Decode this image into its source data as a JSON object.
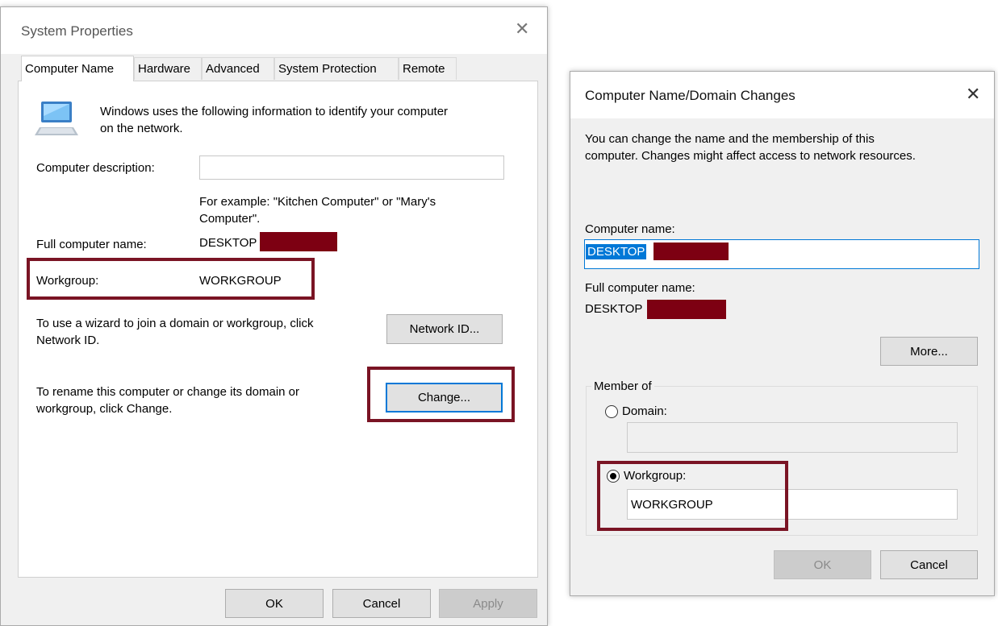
{
  "system_properties": {
    "title": "System Properties",
    "tabs": [
      {
        "label": "Computer Name",
        "active": true
      },
      {
        "label": "Hardware"
      },
      {
        "label": "Advanced"
      },
      {
        "label": "System Protection"
      },
      {
        "label": "Remote"
      }
    ],
    "intro_text_1": "Windows uses the following information to identify your computer",
    "intro_text_2": "on the network.",
    "computer_description_label": "Computer description:",
    "computer_description_value": "",
    "example_text_1": "For example: \"Kitchen Computer\" or \"Mary's",
    "example_text_2": "Computer\".",
    "full_name_label": "Full computer name:",
    "full_name_value": "DESKTOP",
    "workgroup_label": "Workgroup:",
    "workgroup_value": "WORKGROUP",
    "network_id_text_1": "To use a wizard to join a domain or workgroup, click",
    "network_id_text_2": "Network ID.",
    "network_id_button": "Network ID...",
    "rename_text_1": "To rename this computer or change its domain or",
    "rename_text_2": "workgroup, click Change.",
    "change_button": "Change...",
    "ok_button": "OK",
    "cancel_button": "Cancel",
    "apply_button": "Apply"
  },
  "domain_changes": {
    "title": "Computer Name/Domain Changes",
    "intro_text_1": "You can change the name and the membership of this",
    "intro_text_2": "computer. Changes might affect access to network resources.",
    "computer_name_label": "Computer name:",
    "computer_name_value": "DESKTOP",
    "full_name_label": "Full computer name:",
    "full_name_value": "DESKTOP",
    "more_button": "More...",
    "member_of_label": "Member of",
    "domain_label": "Domain:",
    "domain_value": "",
    "workgroup_label": "Workgroup:",
    "workgroup_value": "WORKGROUP",
    "selected_membership": "Workgroup",
    "ok_button": "OK",
    "cancel_button": "Cancel"
  },
  "colors": {
    "highlight_box": "#7a1424",
    "redaction": "#7d0012",
    "selection": "#0078d7",
    "dialog_bg": "#f0f0f0"
  }
}
